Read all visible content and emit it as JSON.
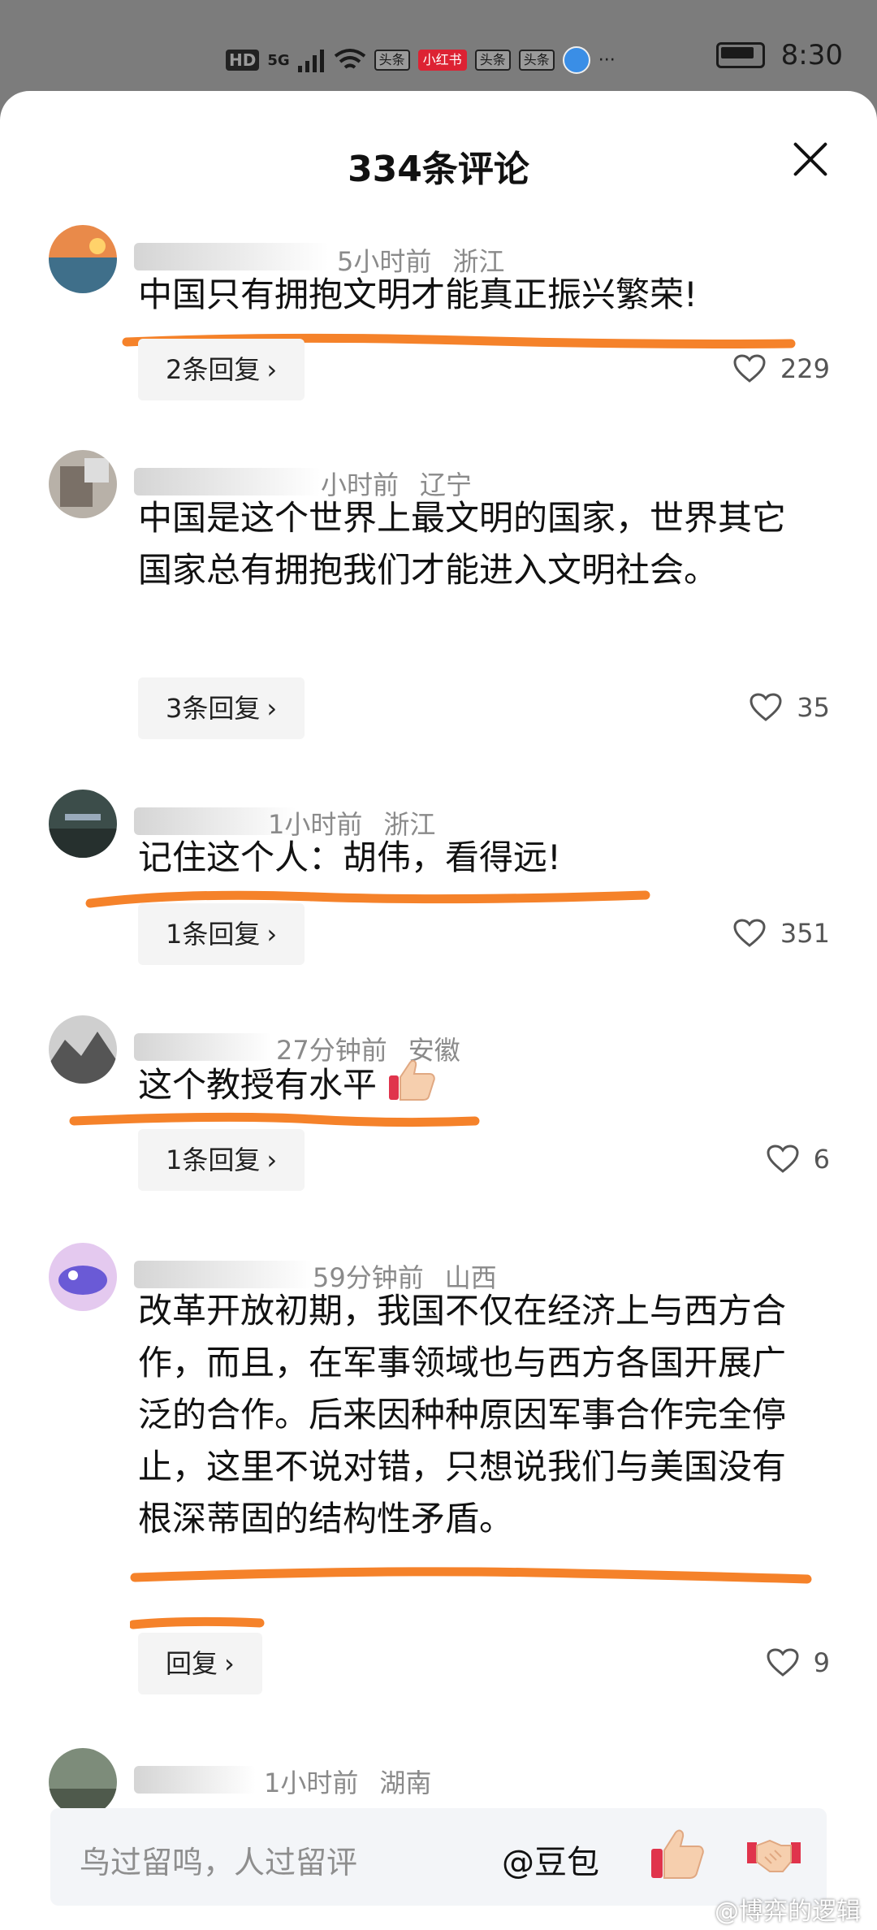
{
  "status_bar": {
    "hd": "HD",
    "network": "5G",
    "apps": [
      "头条",
      "小红书",
      "头条",
      "头条"
    ],
    "more": "···",
    "time": "8:30"
  },
  "sheet": {
    "title": "334条评论",
    "close_icon": "close-icon"
  },
  "comments": [
    {
      "time": "5小时前",
      "location": "浙江",
      "text": "中国只有拥抱文明才能真正振兴繁荣!",
      "reply_label": "2条回复",
      "likes": "229",
      "underlined": true
    },
    {
      "time": "小时前",
      "location": "辽宁",
      "text": "中国是这个世界上最文明的国家，世界其它国家总有拥抱我们才能进入文明社会。",
      "reply_label": "3条回复",
      "likes": "35",
      "underlined": false
    },
    {
      "time": "1小时前",
      "location": "浙江",
      "text": "记住这个人：胡伟，看得远!",
      "reply_label": "1条回复",
      "likes": "351",
      "underlined": true
    },
    {
      "time": "27分钟前",
      "location": "安徽",
      "text": "这个教授有水平",
      "emoji": "thumbs-up-icon",
      "reply_label": "1条回复",
      "likes": "6",
      "underlined": true
    },
    {
      "time": "59分钟前",
      "location": "山西",
      "text": "改革开放初期，我国不仅在经济上与西方合作，而且，在军事领域也与西方各国开展广泛的合作。后来因种种原因军事合作完全停止，这里不说对错，只想说我们与美国没有根深蒂固的结构性矛盾。",
      "reply_label": "回复",
      "likes": "9",
      "underlined": true
    },
    {
      "time": "1小时前",
      "location": "湖南"
    }
  ],
  "input_bar": {
    "placeholder": "鸟过留鸣，人过留评",
    "mention": "@豆包",
    "icons": [
      "thumbs-up-icon",
      "handshake-icon"
    ]
  },
  "watermark": "@博弈的逻辑",
  "colors": {
    "underline": "#f5822a",
    "status_bar_bg": "#7c7c7c",
    "meta_text": "#8a8a8a"
  }
}
